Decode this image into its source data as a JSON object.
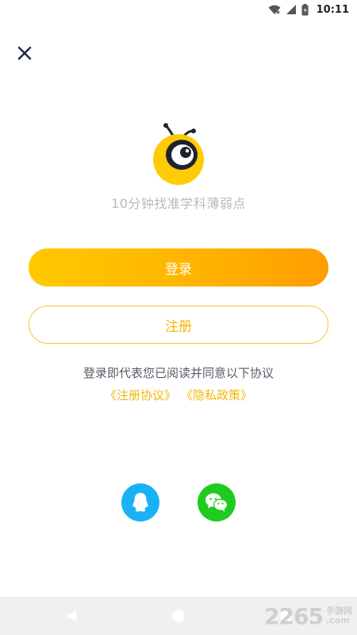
{
  "status_bar": {
    "time": "10:11"
  },
  "header": {
    "close_label": "close"
  },
  "brand": {
    "slogan": "10分钟找准学科薄弱点"
  },
  "actions": {
    "login_label": "登录",
    "register_label": "注册"
  },
  "agreement": {
    "text": "登录即代表您已阅读并同意以下协议",
    "links": [
      "《注册协议》",
      "《隐私政策》"
    ]
  },
  "social": {
    "items": [
      {
        "id": "qq",
        "icon": "qq-icon",
        "color": "#1ab2f5"
      },
      {
        "id": "wechat",
        "icon": "wechat-icon",
        "color": "#1fcb1f"
      }
    ]
  },
  "watermark": {
    "number": "2265",
    "cn": "手游网",
    "domain": ".com"
  },
  "theme": {
    "accent": "#ffb400",
    "text_muted": "#b9b9b9"
  }
}
